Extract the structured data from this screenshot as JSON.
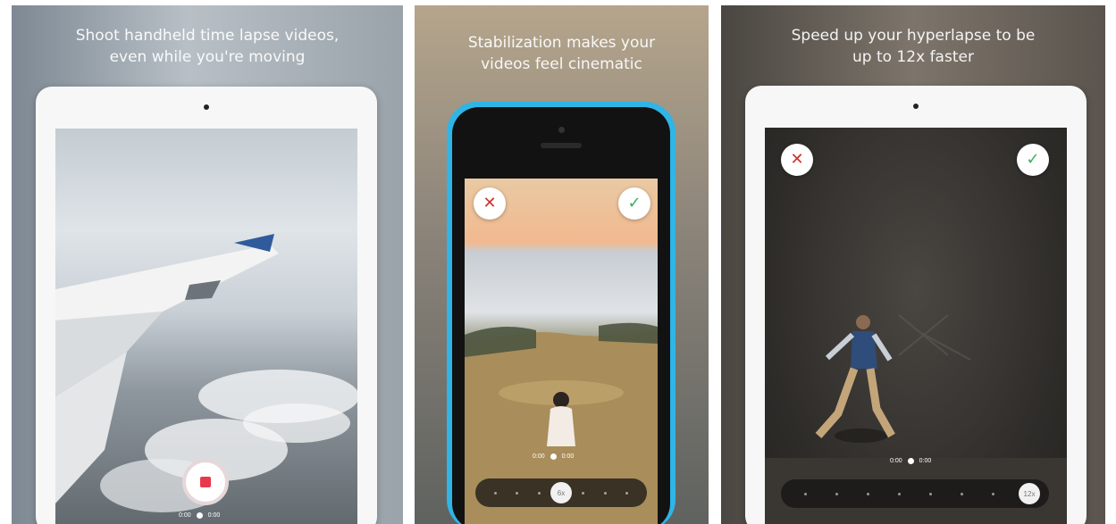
{
  "panels": [
    {
      "headline_line1": "Shoot handheld time lapse videos,",
      "headline_line2": "even while you're moving",
      "timeline": {
        "start": "0:00",
        "end": "0:00"
      }
    },
    {
      "headline_line1": "Stabilization makes your",
      "headline_line2": "videos feel cinematic",
      "timeline": {
        "start": "0:00",
        "end": "0:00"
      },
      "speed_knob": "6x"
    },
    {
      "headline_line1": "Speed up your hyperlapse to be",
      "headline_line2": "up to 12x faster",
      "timeline": {
        "start": "0:00",
        "end": "0:00"
      },
      "speed_knob": "12x"
    }
  ],
  "colors": {
    "record": "#e8394a",
    "cancel": "#d0302a",
    "confirm": "#3fae5c",
    "iphone_body": "#2fb5e6"
  },
  "icons": [
    "record-icon",
    "cancel-icon",
    "confirm-icon"
  ]
}
